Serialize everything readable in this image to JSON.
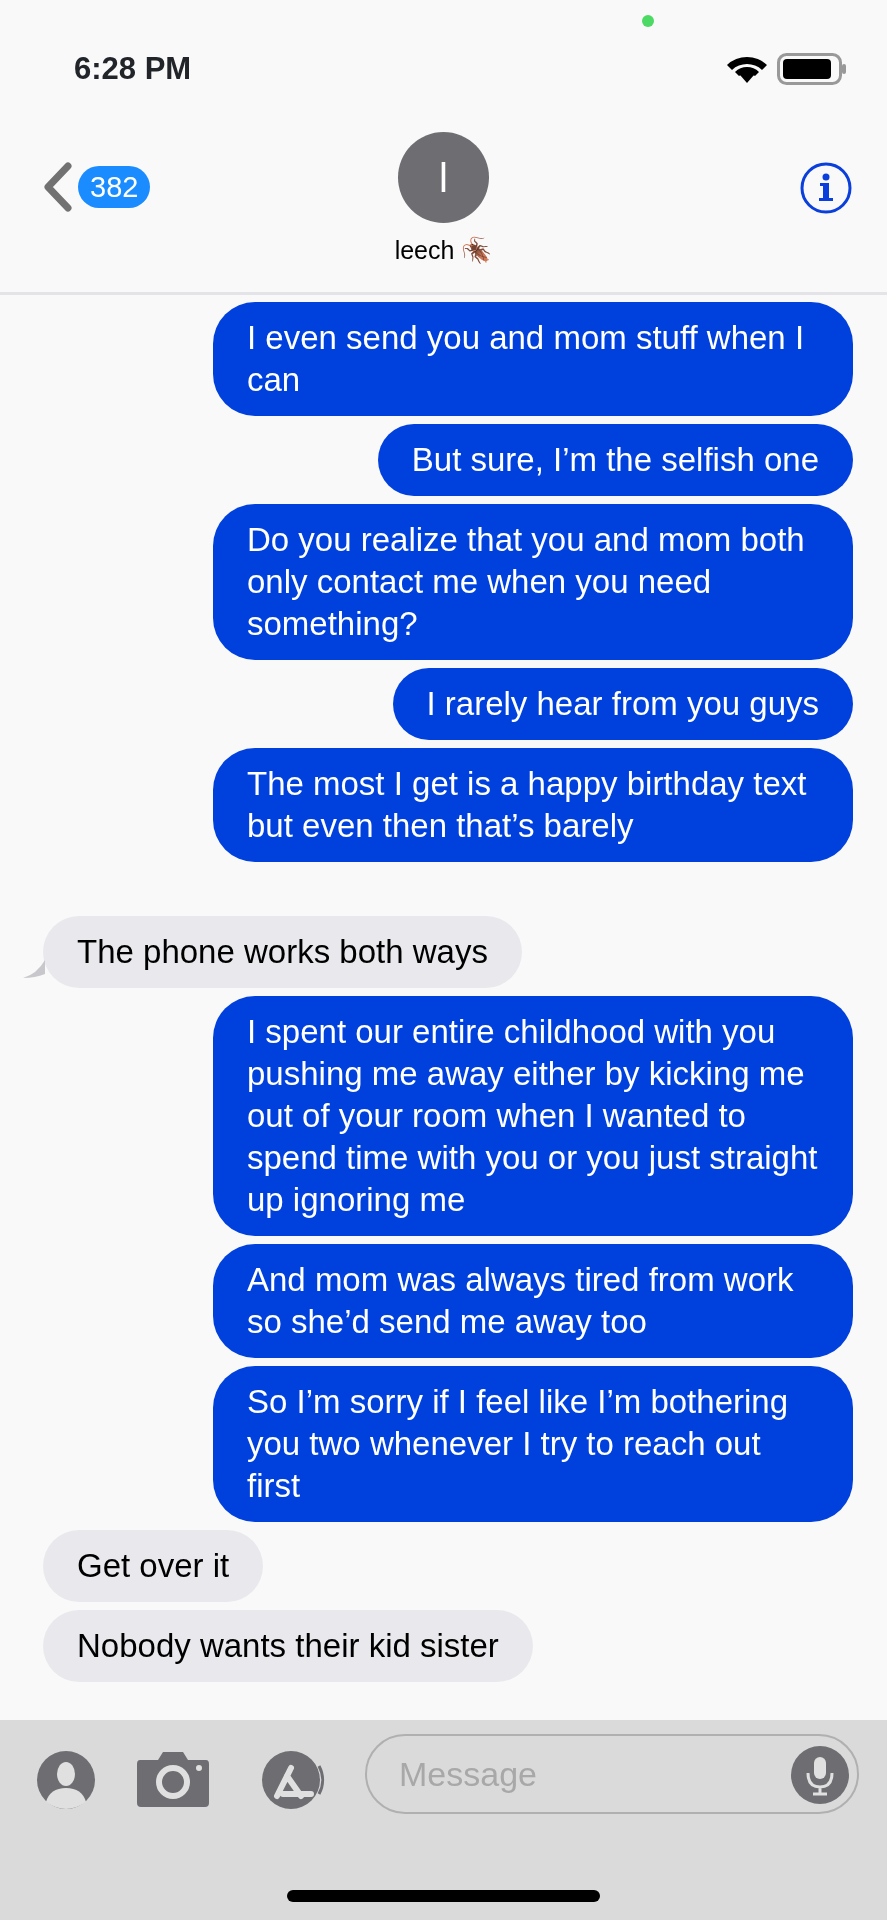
{
  "status_bar": {
    "time": "6:28 PM"
  },
  "header": {
    "unread_count": "382",
    "avatar_initial": "l",
    "contact_name": "leech 🪳"
  },
  "messages": [
    {
      "outgoing": true,
      "text": "I even send you and mom stuff when I can",
      "tail": false
    },
    {
      "outgoing": true,
      "text": "But sure, I’m the selfish one",
      "tail": false
    },
    {
      "outgoing": true,
      "text": "Do you realize that you and mom both only contact me when you need something?",
      "tail": false
    },
    {
      "outgoing": true,
      "text": "I rarely hear from you guys",
      "tail": false
    },
    {
      "outgoing": true,
      "text": "The most I get is a happy birthday text but even then that’s barely",
      "tail": false
    },
    {
      "outgoing": false,
      "text": "The phone works both ways",
      "tail": true
    },
    {
      "outgoing": true,
      "text": "I spent our entire childhood with you pushing me away either by kicking me out of your room when I wanted to spend time with you or you just straight up ignoring me",
      "tail": false
    },
    {
      "outgoing": true,
      "text": "And mom was always tired from work so she’d send me away too",
      "tail": false
    },
    {
      "outgoing": true,
      "text": "So I’m sorry if I feel like I’m bothering you two whenever I try to reach out first",
      "tail": false
    },
    {
      "outgoing": false,
      "text": "Get over it",
      "tail": false
    },
    {
      "outgoing": false,
      "text": "Nobody wants their kid sister",
      "tail": false
    }
  ],
  "composer": {
    "placeholder": "Message"
  }
}
